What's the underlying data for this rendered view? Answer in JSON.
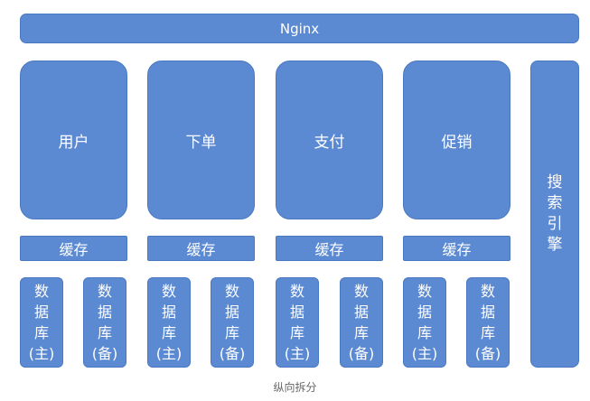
{
  "nginx": "Nginx",
  "services": [
    {
      "name": "用户"
    },
    {
      "name": "下单"
    },
    {
      "name": "支付"
    },
    {
      "name": "促销"
    }
  ],
  "cache_label": "缓存",
  "db_primary": "数\n据\n库\n(主)",
  "db_backup": "数\n据\n库\n(备)",
  "search_engine": "搜\n索\n引\n擎",
  "caption": "纵向拆分",
  "colors": {
    "box_fill": "#5b8ad3",
    "box_border": "#4a79c2",
    "text": "#ffffff"
  }
}
